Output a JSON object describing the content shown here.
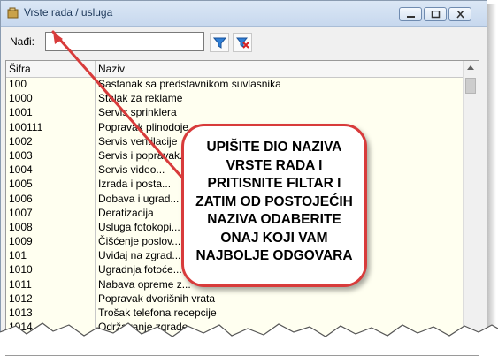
{
  "window": {
    "title": "Vrste rada / usluga"
  },
  "search": {
    "label": "Nađi:",
    "value": "",
    "placeholder": ""
  },
  "table": {
    "headers": {
      "code": "Šifra",
      "name": "Naziv"
    },
    "rows": [
      {
        "code": "100",
        "name": "Sastanak sa predstavnikom suvlasnika"
      },
      {
        "code": "1000",
        "name": "Stalak za reklame"
      },
      {
        "code": "1001",
        "name": "Servis sprinklera"
      },
      {
        "code": "100111",
        "name": "Popravak plinodoje..."
      },
      {
        "code": "1002",
        "name": "Servis ventilacije"
      },
      {
        "code": "1003",
        "name": "Servis i popravak..."
      },
      {
        "code": "1004",
        "name": "Servis video..."
      },
      {
        "code": "1005",
        "name": "Izrada i posta..."
      },
      {
        "code": "1006",
        "name": "Dobava i ugrad..."
      },
      {
        "code": "1007",
        "name": "Deratizacija"
      },
      {
        "code": "1008",
        "name": "Usluga fotokopi..."
      },
      {
        "code": "1009",
        "name": "Čišćenje poslov..."
      },
      {
        "code": "101",
        "name": "Uviđaj na zgrad..."
      },
      {
        "code": "1010",
        "name": "Ugradnja fotoće..."
      },
      {
        "code": "1011",
        "name": "Nabava opreme z..."
      },
      {
        "code": "1012",
        "name": "Popravak dvorišnih vrata"
      },
      {
        "code": "1013",
        "name": "Trošak telefona recepcije"
      },
      {
        "code": "1014",
        "name": "Održavanje zgrade..."
      }
    ]
  },
  "callout": {
    "text": "UPIŠITE DIO NAZIVA VRSTE RADA I PRITISNITE FILTAR I ZATIM OD POSTOJEĆIH NAZIVA ODABERITE ONAJ KOJI VAM NAJBOLJE ODGOVARA"
  },
  "colors": {
    "grid_background": "#fffff0",
    "callout_border": "#d83b3b",
    "arrow": "#d83b3b"
  },
  "icons": {
    "filter": "funnel-icon",
    "clear": "clear-filter-icon"
  }
}
